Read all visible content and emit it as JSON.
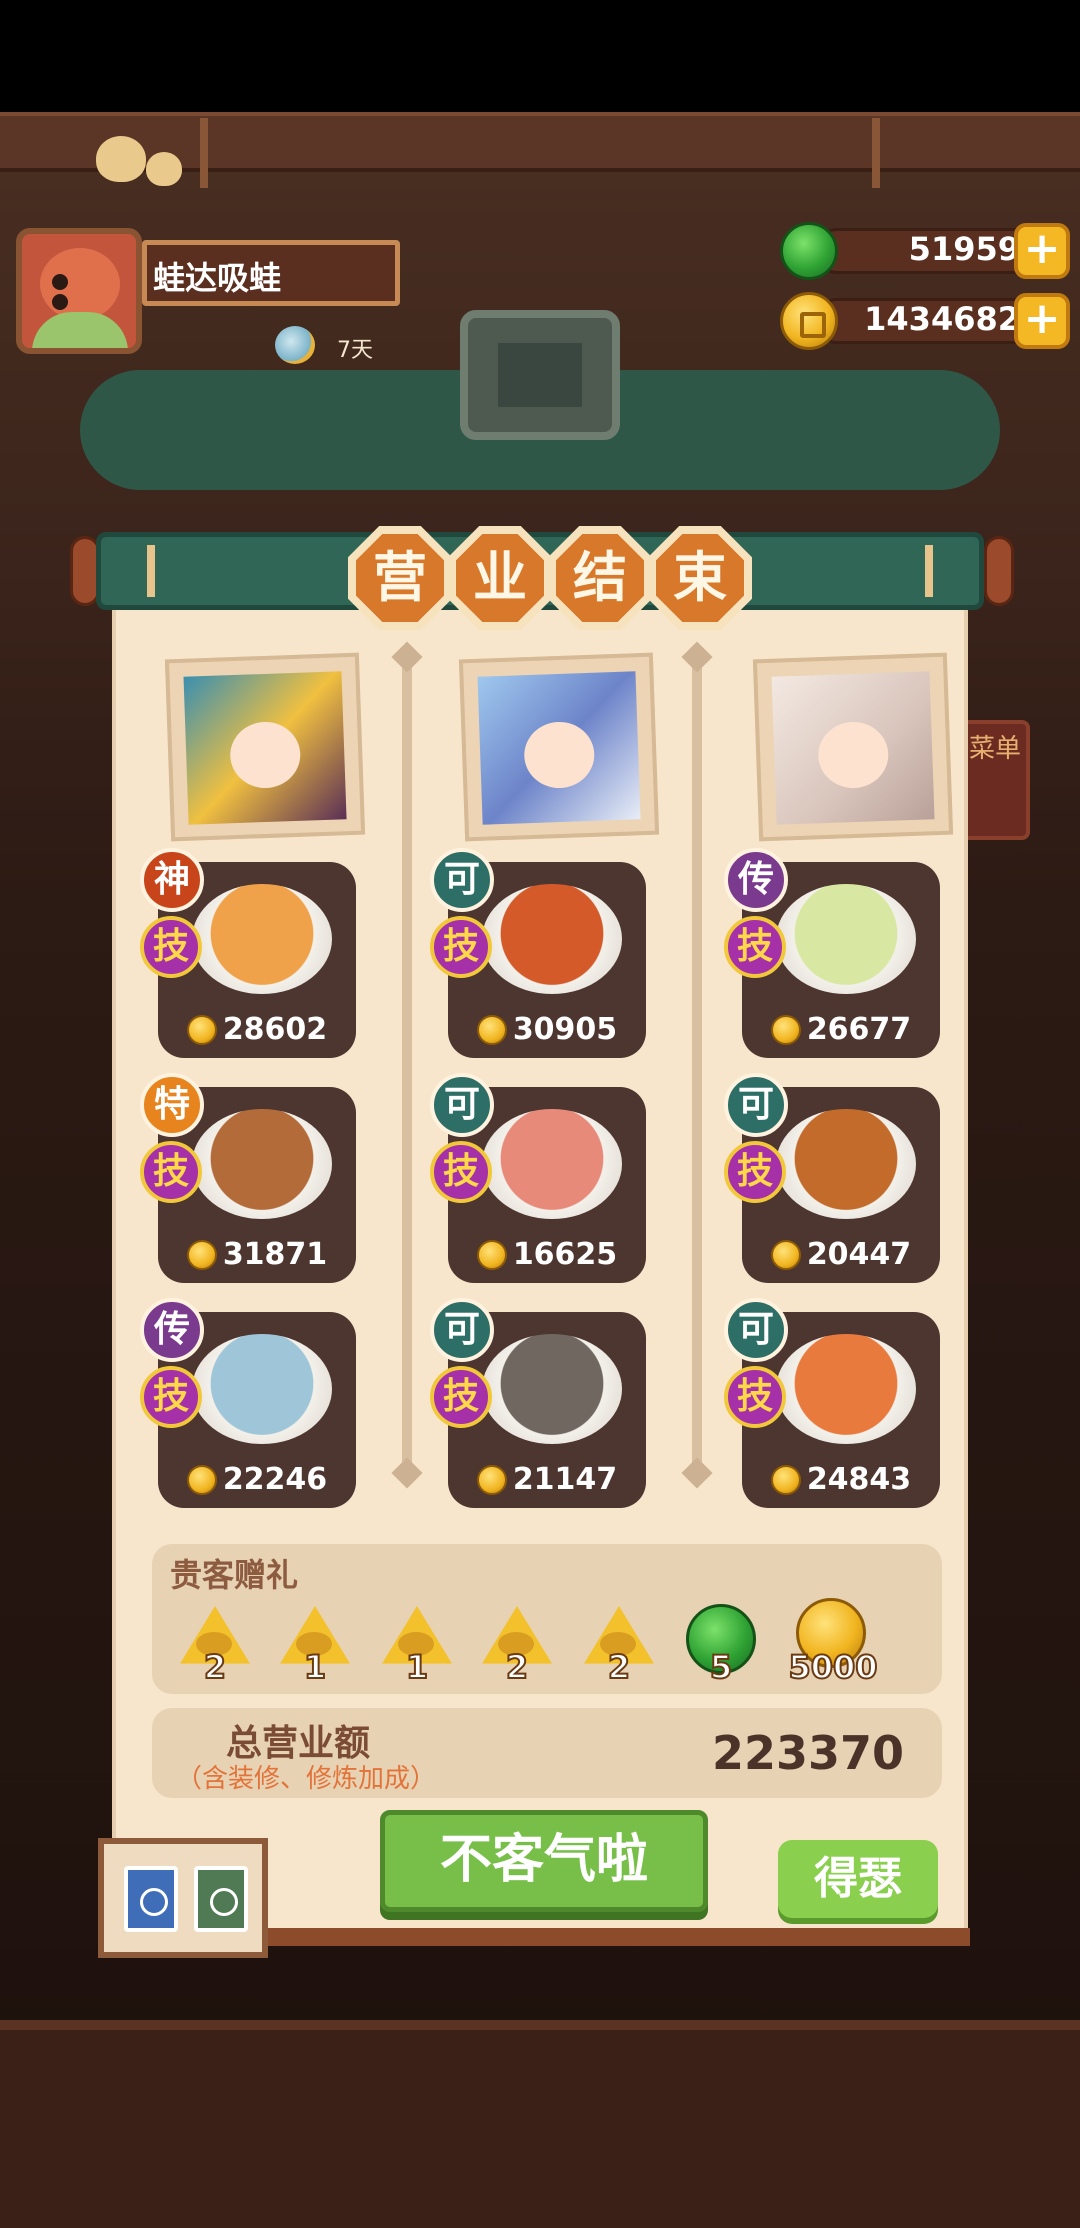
{
  "player": {
    "name": "蛙达吸蛙",
    "days": "7天"
  },
  "currencies": [
    {
      "icon": "jade-orb-icon",
      "value": "51959"
    },
    {
      "icon": "gold-coin-icon",
      "value": "1434682"
    }
  ],
  "title_chars": [
    "营",
    "业",
    "结",
    "束"
  ],
  "columns": [
    {
      "guest": "guest-portrait-dark-hair",
      "dishes": [
        {
          "rank": "神",
          "rank_color": "#c8451c",
          "skill": "技",
          "price": "28602",
          "plate": "#f0a24a"
        },
        {
          "rank": "特",
          "rank_color": "#e7841e",
          "skill": "技",
          "price": "31871",
          "plate": "#b36b3a"
        },
        {
          "rank": "传",
          "rank_color": "#7a3a8e",
          "skill": "技",
          "price": "22246",
          "plate": "#9ec6d8"
        }
      ]
    },
    {
      "guest": "guest-portrait-blue-hair",
      "dishes": [
        {
          "rank": "可",
          "rank_color": "#2d6f67",
          "skill": "技",
          "price": "30905",
          "plate": "#d45a2a"
        },
        {
          "rank": "可",
          "rank_color": "#2d6f67",
          "skill": "技",
          "price": "16625",
          "plate": "#e88a7a"
        },
        {
          "rank": "可",
          "rank_color": "#2d6f67",
          "skill": "技",
          "price": "21147",
          "plate": "#6f6760"
        }
      ]
    },
    {
      "guest": "guest-portrait-white-hood",
      "dishes": [
        {
          "rank": "传",
          "rank_color": "#7a3a8e",
          "skill": "技",
          "price": "26677",
          "plate": "#d8e8a2"
        },
        {
          "rank": "可",
          "rank_color": "#2d6f67",
          "skill": "技",
          "price": "20447",
          "plate": "#c26b2a"
        },
        {
          "rank": "可",
          "rank_color": "#2d6f67",
          "skill": "技",
          "price": "24843",
          "plate": "#e97a3e"
        }
      ]
    }
  ],
  "gifts": {
    "label": "贵客赠礼",
    "items": [
      {
        "icon": "rice-dumpling-wheat-icon",
        "count": "2"
      },
      {
        "icon": "rice-dumpling-swirl-icon",
        "count": "1"
      },
      {
        "icon": "rice-dumpling-flower-icon",
        "count": "1"
      },
      {
        "icon": "rice-dumpling-fish-icon",
        "count": "2"
      },
      {
        "icon": "rice-dumpling-star-icon",
        "count": "2"
      },
      {
        "icon": "jade-orb-icon",
        "count": "5"
      },
      {
        "icon": "gold-coin-icon",
        "count": "5000"
      }
    ]
  },
  "total": {
    "label": "总营业额",
    "note": "（含装修、修炼加成）",
    "value": "223370"
  },
  "buttons": {
    "main": "不客气啦",
    "side": "得瑟"
  },
  "side_lantern": "菜单",
  "colors": {
    "panel": "#f7e6cc",
    "scroll_green": "#2f6656",
    "button_green": "#78bf4a",
    "title_orange": "#d8782a"
  }
}
